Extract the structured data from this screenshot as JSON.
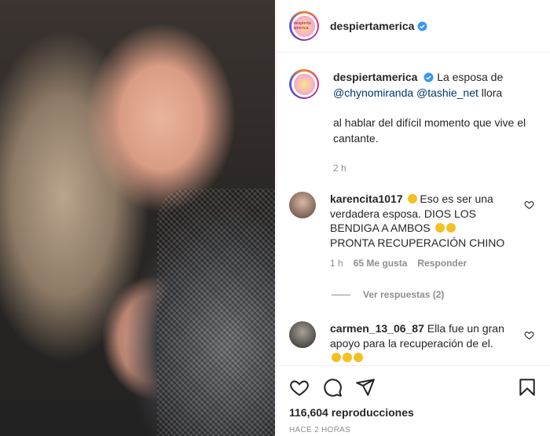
{
  "post": {
    "username": "despiertamerica",
    "avatar_text": "despierta america",
    "caption": {
      "username": "despiertamerica",
      "text_before": "La esposa de",
      "mention_1": "@chynomiranda",
      "mention_2": "@tashie_net",
      "text_after": "llora",
      "line_2": "al hablar del difícil momento que vive el cantante.",
      "time": "2 h"
    },
    "comments": [
      {
        "username": "karencita1017",
        "text": "Eso es ser una verdadera esposa. DIOS LOS BENDIGA A AMBOS",
        "text_2": "PRONTA RECUPERACIÓN CHINO",
        "time": "1 h",
        "likes": "65 Me gusta",
        "reply": "Responder"
      },
      {
        "username": "carmen_13_06_87",
        "text": "Ella fue un gran apoyo para la recuperación de el."
      }
    ],
    "view_replies": "Ver respuestas (2)",
    "views_count": "116,604",
    "views_label": "reproducciones",
    "posted_ago": "HACE 2 HORAS"
  },
  "colors": {
    "verified": "#3897f0",
    "mention": "#00376b",
    "muted": "#8e8e8e"
  }
}
